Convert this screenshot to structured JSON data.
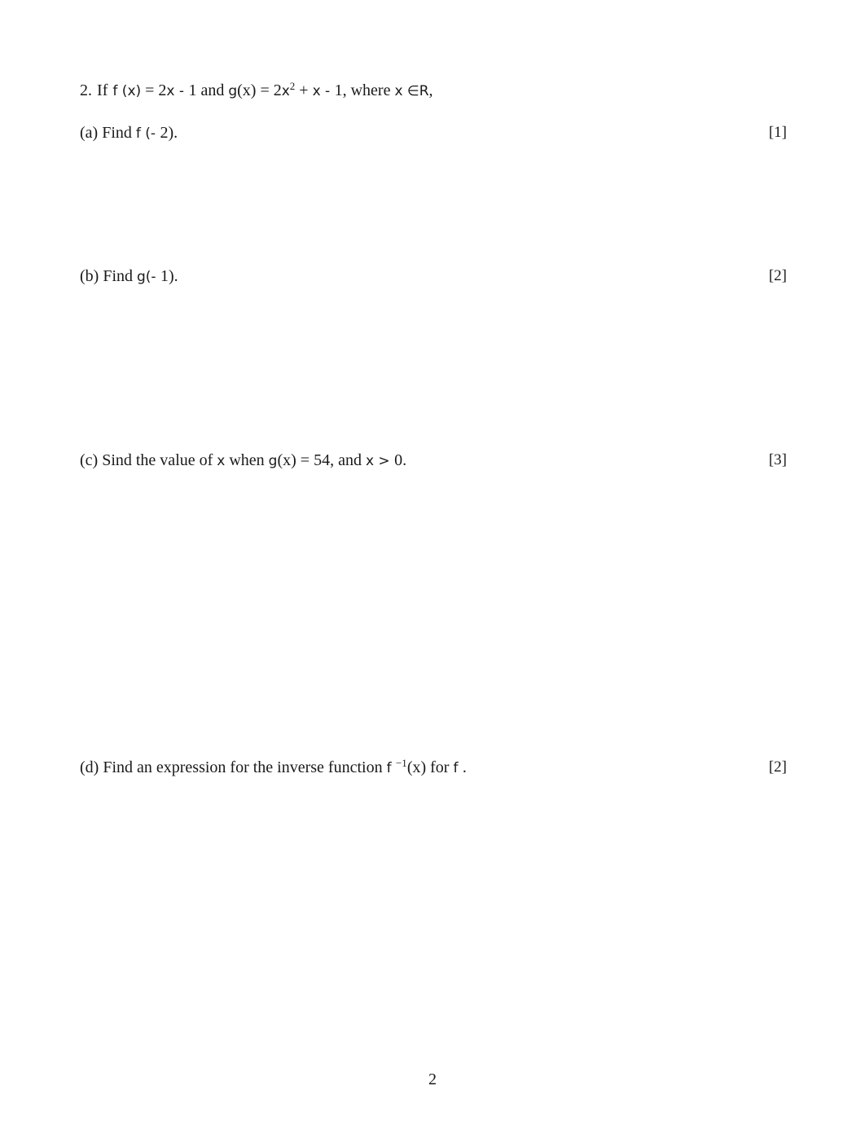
{
  "question": {
    "number": "2.",
    "intro_if": "If",
    "f_def": "f (x)",
    "eq1": " = 2",
    "x1": "x - ",
    "one1": " 1 and ",
    "g_def": "g",
    "gx": "(x)",
    "eq2": " = 2",
    "x2": "x",
    "sq": "2",
    "plus": " + ",
    "x3": "x - ",
    "one2": " 1, where ",
    "x4": "x ",
    "in_r": "∈R",
    "comma": ","
  },
  "parts": [
    {
      "label": "(a) Find ",
      "expr": "f (- ",
      "tail": " 2).",
      "marks": "[1]"
    },
    {
      "label": "(b) Find ",
      "expr": "g(- ",
      "tail": " 1).",
      "marks": "[2]"
    },
    {
      "label": "(c) Sind the value of ",
      "x": "x",
      "mid": " when ",
      "g": "g",
      "gx": "(x)",
      "eq": " = 54, and ",
      "cond": "x > ",
      "tail": " 0.",
      "marks": "[3]"
    },
    {
      "label": "(d) Find an expression for the inverse function ",
      "f": "f ",
      "inv": "−1",
      "fx": "(x)",
      "mid": " for ",
      "f2": "f ",
      "tail": ".",
      "marks": "[2]"
    }
  ],
  "page_number": "2"
}
